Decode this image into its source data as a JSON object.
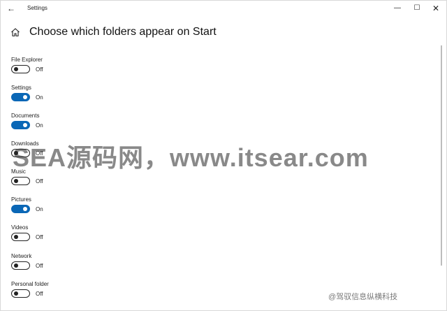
{
  "window": {
    "title": "Settings",
    "back_icon": "arrow-left",
    "controls": {
      "minimize": "—",
      "maximize": "☐",
      "close": "✕"
    }
  },
  "header": {
    "home_icon": "home",
    "title": "Choose which folders appear on Start"
  },
  "settings": [
    {
      "label": "File Explorer",
      "state": "Off",
      "on": false
    },
    {
      "label": "Settings",
      "state": "On",
      "on": true
    },
    {
      "label": "Documents",
      "state": "On",
      "on": true
    },
    {
      "label": "Downloads",
      "state": "Off",
      "on": false
    },
    {
      "label": "Music",
      "state": "Off",
      "on": false
    },
    {
      "label": "Pictures",
      "state": "On",
      "on": true
    },
    {
      "label": "Videos",
      "state": "Off",
      "on": false
    },
    {
      "label": "Network",
      "state": "Off",
      "on": false
    },
    {
      "label": "Personal folder",
      "state": "Off",
      "on": false
    }
  ],
  "overlay": {
    "watermark": "SEA源码网，www.itsear.com",
    "credit": "@驾驭信息纵横科技"
  },
  "colors": {
    "toggle_on": "#0a67b6",
    "toggle_off_border": "#222222"
  }
}
